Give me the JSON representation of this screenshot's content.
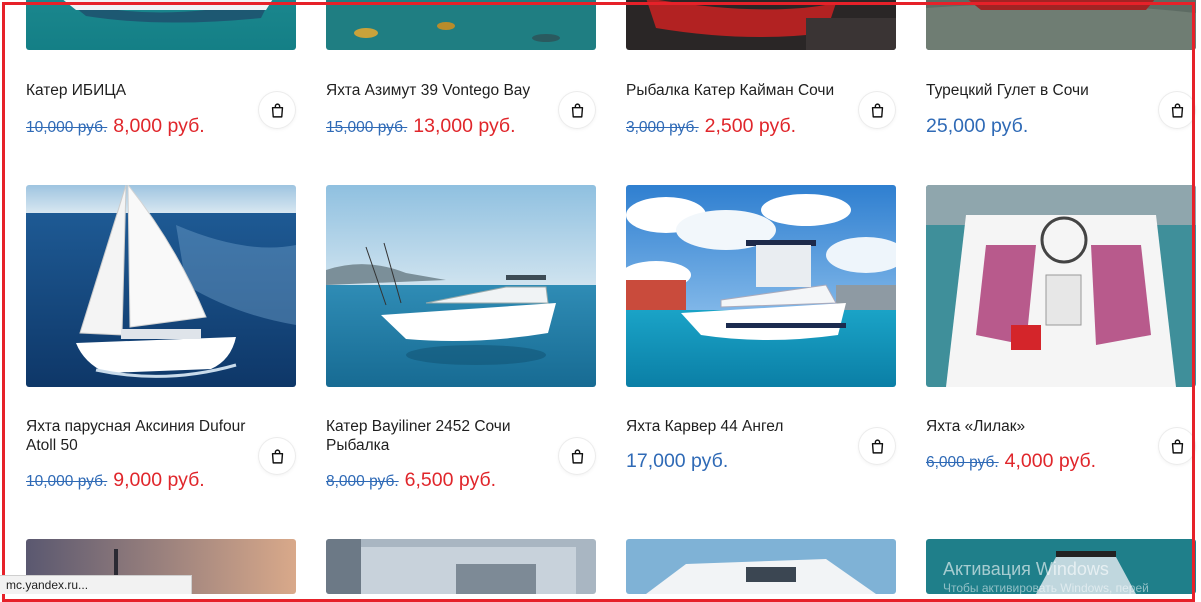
{
  "products": [
    {
      "title": "Катер ИБИЦА",
      "old_price": "10,000 руб.",
      "price": "8,000 руб."
    },
    {
      "title": "Яхта Азимут 39 Vontego Bay",
      "old_price": "15,000 руб.",
      "price": "13,000 руб."
    },
    {
      "title": "Рыбалка Катер Кайман Сочи",
      "old_price": "3,000 руб.",
      "price": "2,500 руб."
    },
    {
      "title": "Турецкий Гулет в Сочи",
      "old_price": "",
      "price": "25,000 руб."
    },
    {
      "title": "Яхта парусная Аксиния Dufour Atoll 50",
      "old_price": "10,000 руб.",
      "price": "9,000 руб."
    },
    {
      "title": "Катер Bayiliner 2452 Сочи Рыбалка",
      "old_price": "8,000 руб.",
      "price": "6,500 руб."
    },
    {
      "title": "Яхта Карвер 44 Ангел",
      "old_price": "",
      "price": "17,000 руб."
    },
    {
      "title": "Яхта «Лилак»",
      "old_price": "6,000 руб.",
      "price": "4,000 руб."
    }
  ],
  "status_bar": {
    "url": "mc.yandex.ru..."
  },
  "watermark": {
    "line1": "Активация Windows",
    "line2": "Чтобы активировать Windows, перей"
  },
  "icons": {
    "cart": "shopping-bag-icon"
  },
  "colors": {
    "frame": "#e62129",
    "sale_price": "#e0262b",
    "regular_price": "#2f6ab6"
  }
}
